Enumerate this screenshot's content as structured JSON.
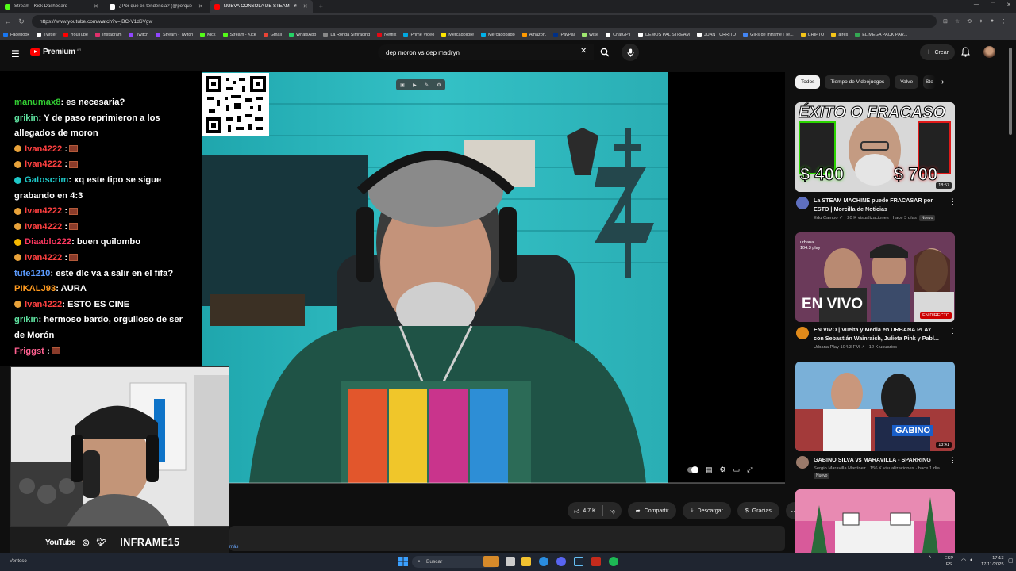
{
  "browser": {
    "tabs": [
      {
        "title": "Stream - Kick Dashboard",
        "color": "#53fc18",
        "active": false
      },
      {
        "title": "¿Por qué es tendencia? (@porque",
        "color": "#ffffff",
        "active": false
      },
      {
        "title": "NUEVA CONSOLA DE STEAM - Yo",
        "color": "#ff0000",
        "active": true
      }
    ],
    "new_tab": "+",
    "url": "https://www.youtube.com/watch?v=jBC-V1d6Vgw",
    "bookmarks": [
      {
        "label": "Facebook",
        "color": "#1877f2"
      },
      {
        "label": "Twitter",
        "color": "#ffffff"
      },
      {
        "label": "YouTube",
        "color": "#ff0000"
      },
      {
        "label": "Instagram",
        "color": "#e1306c"
      },
      {
        "label": "Twitch",
        "color": "#9146ff"
      },
      {
        "label": "Stream - Twitch",
        "color": "#9146ff"
      },
      {
        "label": "Kick",
        "color": "#53fc18"
      },
      {
        "label": "Stream - Kick",
        "color": "#53fc18"
      },
      {
        "label": "Gmail",
        "color": "#ea4335"
      },
      {
        "label": "WhatsApp",
        "color": "#25d366"
      },
      {
        "label": "La Ronda Simracing",
        "color": "#888888"
      },
      {
        "label": "Netflix",
        "color": "#e50914"
      },
      {
        "label": "Prime Video",
        "color": "#00a8e1"
      },
      {
        "label": "Mercadolibre",
        "color": "#ffe600"
      },
      {
        "label": "Mercadopago",
        "color": "#00b1ea"
      },
      {
        "label": "Amazon.",
        "color": "#ff9900"
      },
      {
        "label": "PayPal",
        "color": "#003087"
      },
      {
        "label": "Wise",
        "color": "#9fe870"
      },
      {
        "label": "ChatGPT",
        "color": "#ffffff"
      },
      {
        "label": "DEMOS PAL STREAM",
        "color": "#ffffff"
      },
      {
        "label": "JUAN TURRITO",
        "color": "#ffffff"
      },
      {
        "label": "GIFs de Inframe | Te...",
        "color": "#4285f4"
      },
      {
        "label": "CRIPTO",
        "color": "#f5c518"
      },
      {
        "label": "aires",
        "color": "#f5c518"
      },
      {
        "label": "EL MEGA PACK PAR...",
        "color": "#34a853"
      }
    ]
  },
  "youtube": {
    "brand": "Premium",
    "region": "AR",
    "search_query": "dep moron vs dep madryn",
    "create_label": "Crear",
    "create_plus": "+"
  },
  "chat": [
    {
      "user": "manumax8",
      "color": "#32cd32",
      "text": ": es necesaria?",
      "badge": "",
      "emote": false
    },
    {
      "user": "grikin",
      "color": "#5fe3a1",
      "text": ": Y de paso reprimieron a los allegados de moron",
      "badge": "",
      "emote": false
    },
    {
      "user": "Ivan4222",
      "color": "#ff4040",
      "text": " :",
      "badge": "#e8a23a",
      "emote": true
    },
    {
      "user": "Ivan4222",
      "color": "#ff4040",
      "text": " :",
      "badge": "#e8a23a",
      "emote": true
    },
    {
      "user": "Gatoscrim",
      "color": "#1ec8c8",
      "text": ": xq este tipo se sigue grabando en 4:3",
      "badge": "#1ec8c8",
      "emote": false
    },
    {
      "user": "Ivan4222",
      "color": "#ff4040",
      "text": " :",
      "badge": "#e8a23a",
      "emote": true
    },
    {
      "user": "Ivan4222",
      "color": "#ff4040",
      "text": " :",
      "badge": "#e8a23a",
      "emote": true
    },
    {
      "user": "Diaablo222",
      "color": "#ff3860",
      "text": ": buen quilombo",
      "badge": "#f5b800",
      "emote": false
    },
    {
      "user": "Ivan4222",
      "color": "#ff4040",
      "text": " :",
      "badge": "#e8a23a",
      "emote": true
    },
    {
      "user": "tute1210",
      "color": "#5b9bff",
      "text": ": este dlc va a salir en el fifa?",
      "badge": "",
      "emote": false
    },
    {
      "user": "PIKALJ93",
      "color": "#ff9a1f",
      "text": ": AURA",
      "badge": "",
      "emote": false
    },
    {
      "user": "Ivan4222",
      "color": "#ff4040",
      "text": ": ESTO ES CINE",
      "badge": "#e8a23a",
      "emote": false
    },
    {
      "user": "grikin",
      "color": "#5fe3a1",
      "text": ": hermoso bardo, orgulloso de ser de Morón",
      "badge": "",
      "emote": false
    },
    {
      "user": "Friggst",
      "color": "#ff6090",
      "text": " :",
      "badge": "",
      "emote": true
    }
  ],
  "webcam_footer": {
    "youtube": "YouTube",
    "channel": "INFRAME15"
  },
  "actions": {
    "likes": "4,7 K",
    "share": "Compartir",
    "download": "Descargar",
    "thanks": "Gracias",
    "more": "···"
  },
  "description_more": "más",
  "chips": [
    "Todos",
    "Tiempo de Videojuegos",
    "Valve",
    "Ste"
  ],
  "recommendations": [
    {
      "title": "La STEAM MACHINE puede FRACASAR por ESTO | Morcilla de Noticias",
      "meta": "Edu Campo ✓ · 20 K visualizaciones · hace 3 días",
      "badge": "Nuevo",
      "duration": "18:57",
      "thumb_text_top": "ÉXITO O FRACASO",
      "thumb_text_left": "$ 400",
      "thumb_text_right": "$ 700"
    },
    {
      "title": "EN VIVO | Vuelta y Media en URBANA PLAY con Sebastián Wainraich, Julieta Pink y Pabl...",
      "meta": "Urbana Play 104.3 FM ✓ · 12 K usuarios",
      "badge": "",
      "duration": "EN DIRECTO",
      "thumb_text_top": "urbana 104.3 play",
      "thumb_text_left": "EN VIVO",
      "thumb_text_right": ""
    },
    {
      "title": "GABINO SILVA vs MARAVILLA - SPARRING",
      "meta": "Sergio Maravilla Martínez · 156 K visualizaciones · hace 1 día",
      "badge": "Nuevo",
      "duration": "13:41",
      "thumb_text_top": "",
      "thumb_text_left": "GABINO",
      "thumb_text_right": ""
    }
  ],
  "taskbar": {
    "weather": "Ventoso",
    "search": "Buscar",
    "lang_top": "ESP",
    "lang_bottom": "ES",
    "time": "17:13",
    "date": "17/11/2025"
  }
}
